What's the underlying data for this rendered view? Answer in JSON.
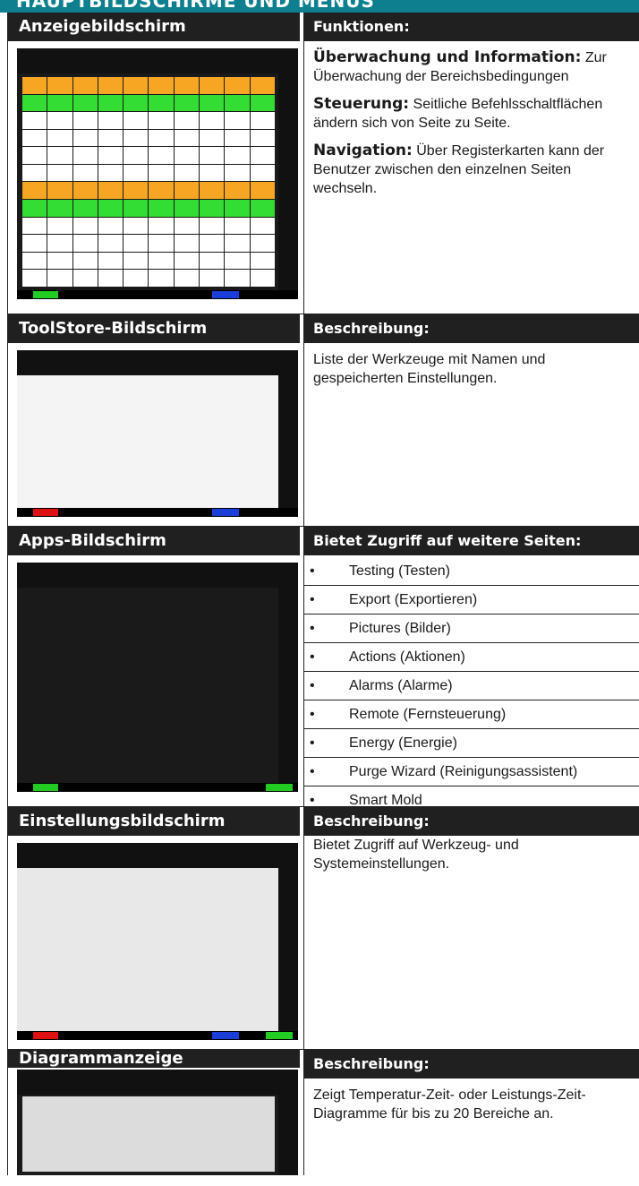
{
  "banner": {
    "title": "HAUPTBILDSCHIRME UND MENÜS"
  },
  "rows": [
    {
      "left_title": "Anzeigebildschirm",
      "right_title": "Funktionen:"
    },
    {
      "left_title": "ToolStore-Bildschirm",
      "right_title": "Beschreibung:"
    },
    {
      "left_title": "Apps-Bildschirm",
      "right_title": "Bietet Zugriff auf weitere Seiten:"
    },
    {
      "left_title": "Einstellungsbildschirm",
      "right_title": "Beschreibung:"
    },
    {
      "left_title": "Diagrammanzeige",
      "right_title": "Beschreibung:"
    }
  ],
  "funktionen": [
    {
      "bold": "Überwachung und Information:",
      "text": " Zur Überwachung der Bereichsbedingungen"
    },
    {
      "bold": "Steuerung:",
      "text": " Seitliche Befehlsschaltflächen ändern sich von Seite zu Seite."
    },
    {
      "bold": "Navigation:",
      "text": " Über Registerkarten kann der Benutzer zwischen den einzelnen Seiten wechseln."
    }
  ],
  "toolstore_desc": "Liste der Werkzeuge mit Namen und gespeicherten Einstellungen.",
  "apps_list": [
    "Testing (Testen)",
    "Export (Exportieren)",
    "Pictures (Bilder)",
    "Actions (Aktionen)",
    "Alarms (Alarme)",
    "Remote (Fernsteuerung)",
    "Energy (Energie)",
    "Purge Wizard (Reinigungsassistent)",
    "Smart Mold"
  ],
  "settings_desc": "Bietet Zugriff auf Werkzeug- und Systemeinstellungen.",
  "graph_desc": "Zeigt Temperatur-Zeit- oder Leistungs-Zeit-Diagramme für bis zu 20 Bereiche an.",
  "colors": {
    "banner": "#0e7f8f",
    "header": "#202020",
    "status_green": "#22cc22",
    "status_red": "#dd1111",
    "status_blue": "#1a3fd9"
  }
}
